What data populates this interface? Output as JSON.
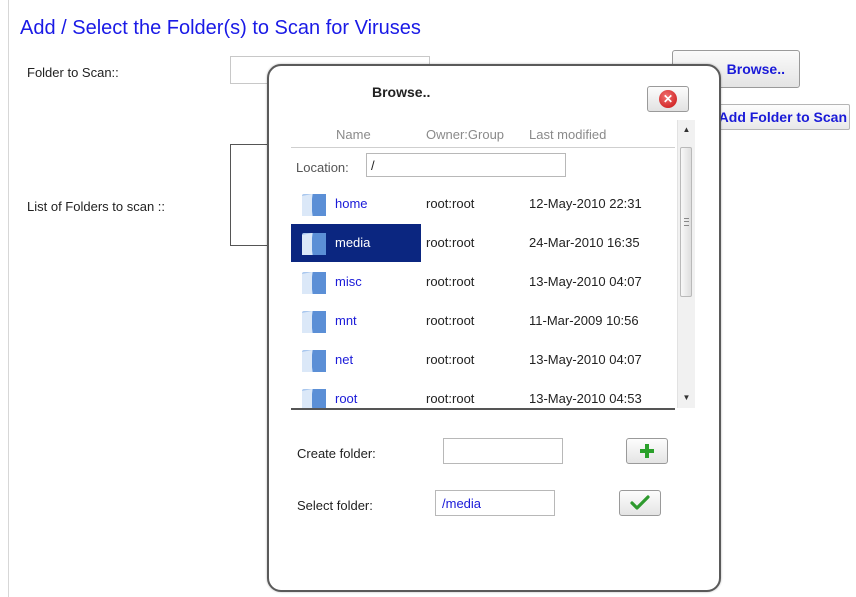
{
  "page": {
    "title": "Add / Select the Folder(s) to Scan for Viruses",
    "folder_to_scan_label": "Folder to Scan::",
    "folder_to_scan_value": "",
    "list_of_folders_label": "List of Folders to scan ::",
    "browse_button": "Browse..",
    "add_folder_button": "Add Folder to Scan"
  },
  "dialog": {
    "title": "Browse..",
    "columns": {
      "name": "Name",
      "owner": "Owner:Group",
      "modified": "Last modified"
    },
    "location_label": "Location:",
    "location_value": "/",
    "rows": [
      {
        "name": "home",
        "owner": "root:root",
        "modified": "12-May-2010  22:31",
        "selected": false
      },
      {
        "name": "media",
        "owner": "root:root",
        "modified": "24-Mar-2010  16:35",
        "selected": true
      },
      {
        "name": "misc",
        "owner": "root:root",
        "modified": "13-May-2010  04:07",
        "selected": false
      },
      {
        "name": "mnt",
        "owner": "root:root",
        "modified": "11-Mar-2009  10:56",
        "selected": false
      },
      {
        "name": "net",
        "owner": "root:root",
        "modified": "13-May-2010  04:07",
        "selected": false
      },
      {
        "name": "root",
        "owner": "root:root",
        "modified": "13-May-2010  04:53",
        "selected": false
      }
    ],
    "create_folder_label": "Create folder:",
    "create_folder_value": "",
    "select_folder_label": "Select folder:",
    "select_folder_value": "/media"
  },
  "icons": {
    "close": "close-icon",
    "add": "plus-icon",
    "confirm": "checkmark-icon",
    "folder": "folder-icon"
  },
  "colors": {
    "title_blue": "#1a1ae6",
    "link_blue": "#1a1ad8",
    "selection": "#0b2680",
    "close_red": "#c81010",
    "plus_green": "#2aa02a"
  }
}
